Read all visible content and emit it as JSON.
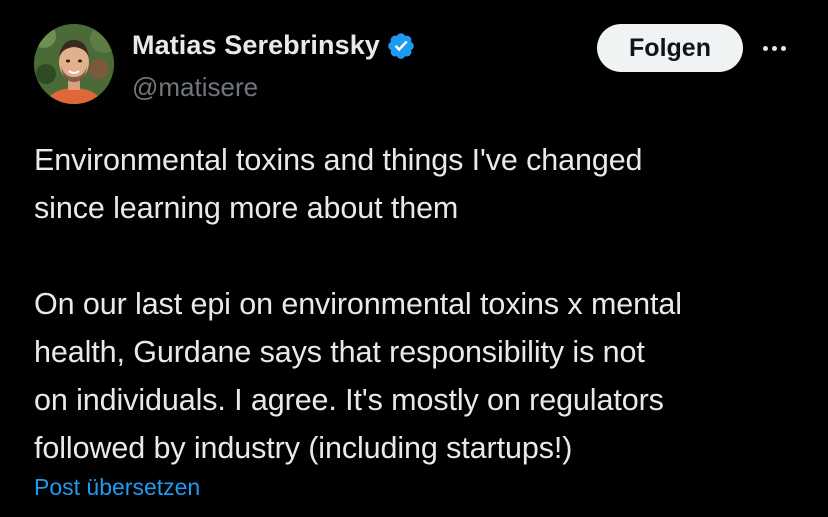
{
  "author": {
    "display_name": "Matias Serebrinsky",
    "handle": "@matisere",
    "verified": true,
    "verified_color": "#1d9bf0"
  },
  "actions": {
    "follow_label": "Folgen",
    "more_icon": "more-horizontal-icon"
  },
  "tweet": {
    "lines_paragraph_1": [
      "Environmental toxins and things I've changed",
      "since learning more about them"
    ],
    "lines_paragraph_2": [
      "On our last epi on environmental toxins x mental",
      "health, Gurdane says that responsibility is not",
      "on individuals. I agree. It's mostly on regulators",
      "followed by industry (including startups!)"
    ]
  },
  "translate_label": "Post übersetzen",
  "colors": {
    "background": "#000000",
    "text_primary": "#e7e9ea",
    "text_secondary": "#71767b",
    "link": "#1d9bf0",
    "button_bg": "#eff3f4"
  }
}
